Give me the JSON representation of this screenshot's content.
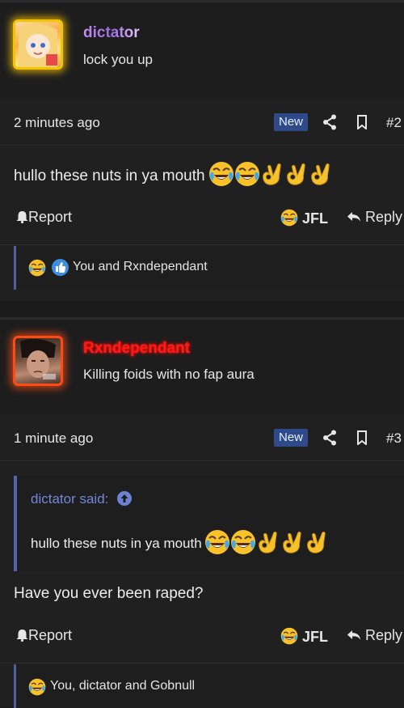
{
  "posts": [
    {
      "username": "dictator",
      "user_title": "lock you up",
      "time": "2 minutes ago",
      "badge": "New",
      "post_number": "#2",
      "body_text": "hullo these nuts in ya mouth",
      "report_label": "Report",
      "reaction_label": "JFL",
      "reply_label": "Reply",
      "reactions_summary": "You and Rxndependant"
    },
    {
      "username": "Rxndependant",
      "user_title": "Killing foids with no fap aura",
      "time": "1 minute ago",
      "badge": "New",
      "post_number": "#3",
      "quote_author": "dictator said:",
      "quote_text": "hullo these nuts in ya mouth",
      "body_text": "Have you ever been raped?",
      "report_label": "Report",
      "reaction_label": "JFL",
      "reply_label": "Reply",
      "reactions_summary": "You, dictator and Gobnull"
    }
  ],
  "colors": {
    "accent": "#2f4a8a",
    "quote_author": "#7387d6",
    "username_1": "#b07ee8",
    "username_2": "#ff1a1a"
  },
  "icons": [
    "share-icon",
    "bookmark-icon",
    "bell-icon",
    "reply-arrow-icon",
    "laughing-emoji-icon",
    "ok-hand-emoji-icon",
    "thumbs-up-icon",
    "arrow-up-circle-icon"
  ]
}
